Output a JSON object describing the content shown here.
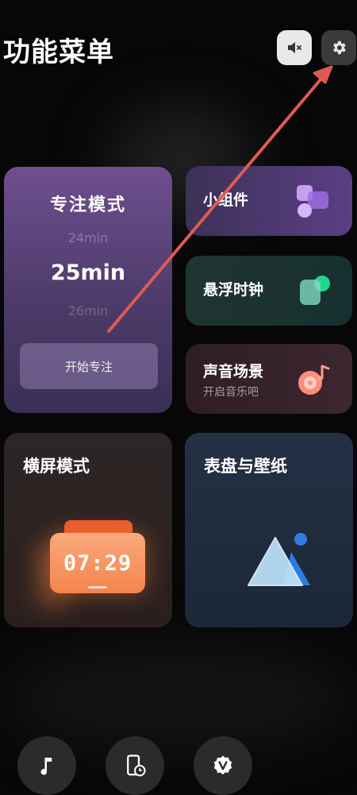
{
  "header": {
    "title": "功能菜单",
    "mute_icon": "speaker-mute-icon",
    "settings_icon": "gear-icon"
  },
  "focus_mode": {
    "title": "专注模式",
    "time_prev": "24min",
    "time_current": "25min",
    "time_next": "26min",
    "start_label": "开始专注"
  },
  "small_cards": {
    "widget": {
      "title": "小组件",
      "icon": "widgets-icon"
    },
    "floating_clock": {
      "title": "悬浮时钟",
      "icon": "floating-clock-icon"
    },
    "sound_scene": {
      "title": "声音场景",
      "subtitle": "开启音乐吧",
      "icon": "music-disc-icon"
    }
  },
  "big_cards": {
    "landscape": {
      "title": "横屏模式",
      "clock_time": "07:29"
    },
    "dial_wallpaper": {
      "title": "表盘与壁纸",
      "icon": "image-mountain-icon"
    }
  },
  "dock": [
    {
      "icon": "music-note-icon"
    },
    {
      "icon": "phone-clock-icon"
    },
    {
      "icon": "badge-v-icon"
    }
  ],
  "colors": {
    "background": "#070707",
    "arrow": "#e05a55",
    "focus_card": "#6e4f8f",
    "clock_accent": "#f5844d"
  }
}
